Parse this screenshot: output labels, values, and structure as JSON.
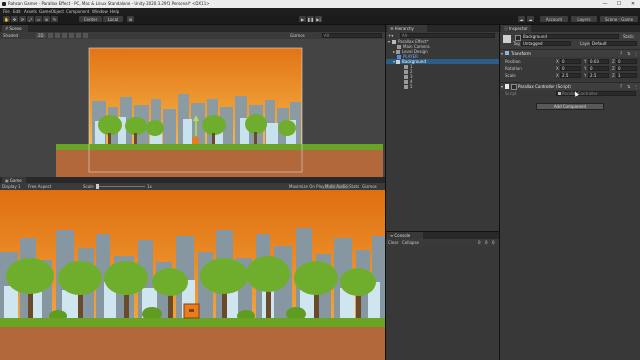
{
  "window": {
    "title": "Rahsan Gamer - Parallax Effect - PC, Mac & Linux Standalone - Unity 2020.3.29f1 Personal* <DX11>",
    "min": "—",
    "max": "☐",
    "close": "✕"
  },
  "menu": [
    "File",
    "Edit",
    "Assets",
    "GameObject",
    "Component",
    "Window",
    "Help"
  ],
  "toolbar": {
    "center": "Center",
    "local": "Local",
    "account": "Account",
    "layers": "Layers",
    "layout": "Scene - Game"
  },
  "scene": {
    "tab": "Scene",
    "shaded": "Shaded",
    "mode_2d": "2D",
    "gizmos": "Gizmos",
    "search_placeholder": "All"
  },
  "game": {
    "tab": "Game",
    "display": "Display 1",
    "aspect": "Free Aspect",
    "scale_label": "Scale",
    "scale_value": "1x",
    "maximize": "Maximize On Play",
    "mute": "Mute Audio",
    "stats": "Stats",
    "gizmos": "Gizmos"
  },
  "hierarchy": {
    "tab": "Hierarchy",
    "search_placeholder": "All",
    "scene_root": "Parallax Effect*",
    "items": [
      "Main Camera",
      "Level Design",
      "PLAYER",
      "Background",
      "1",
      "2",
      "3",
      "4",
      "5"
    ]
  },
  "console": {
    "tab": "Console",
    "clear": "Clear",
    "collapse": "Collapse",
    "count_info": "0",
    "count_warn": "0",
    "count_error": "0"
  },
  "inspector": {
    "tab": "Inspector",
    "object_name": "Background",
    "static": "Static",
    "tag_label": "Tag",
    "tag_value": "Untagged",
    "layer_label": "Layer",
    "layer_value": "Default",
    "transform": {
      "title": "Transform",
      "position_label": "Position",
      "position": [
        "0",
        "0.03",
        "0"
      ],
      "rotation_label": "Rotation",
      "rotation": [
        "0",
        "0",
        "0"
      ],
      "scale_label": "Scale",
      "scale": [
        "2.5",
        "2.5",
        "1"
      ],
      "axis": [
        "X",
        "Y",
        "Z"
      ]
    },
    "script_component": {
      "title": "Parallax Controller (Script)",
      "script_label": "Script",
      "script_value": "ParallaxController"
    },
    "add_component": "Add Component"
  },
  "colors": {
    "accent": "#3a79bb",
    "sky_top": "#e07a1e",
    "sky_bottom": "#f7b64a",
    "grass": "#6aa425",
    "dirt": "#b2683a",
    "player": "#e87d1e"
  }
}
